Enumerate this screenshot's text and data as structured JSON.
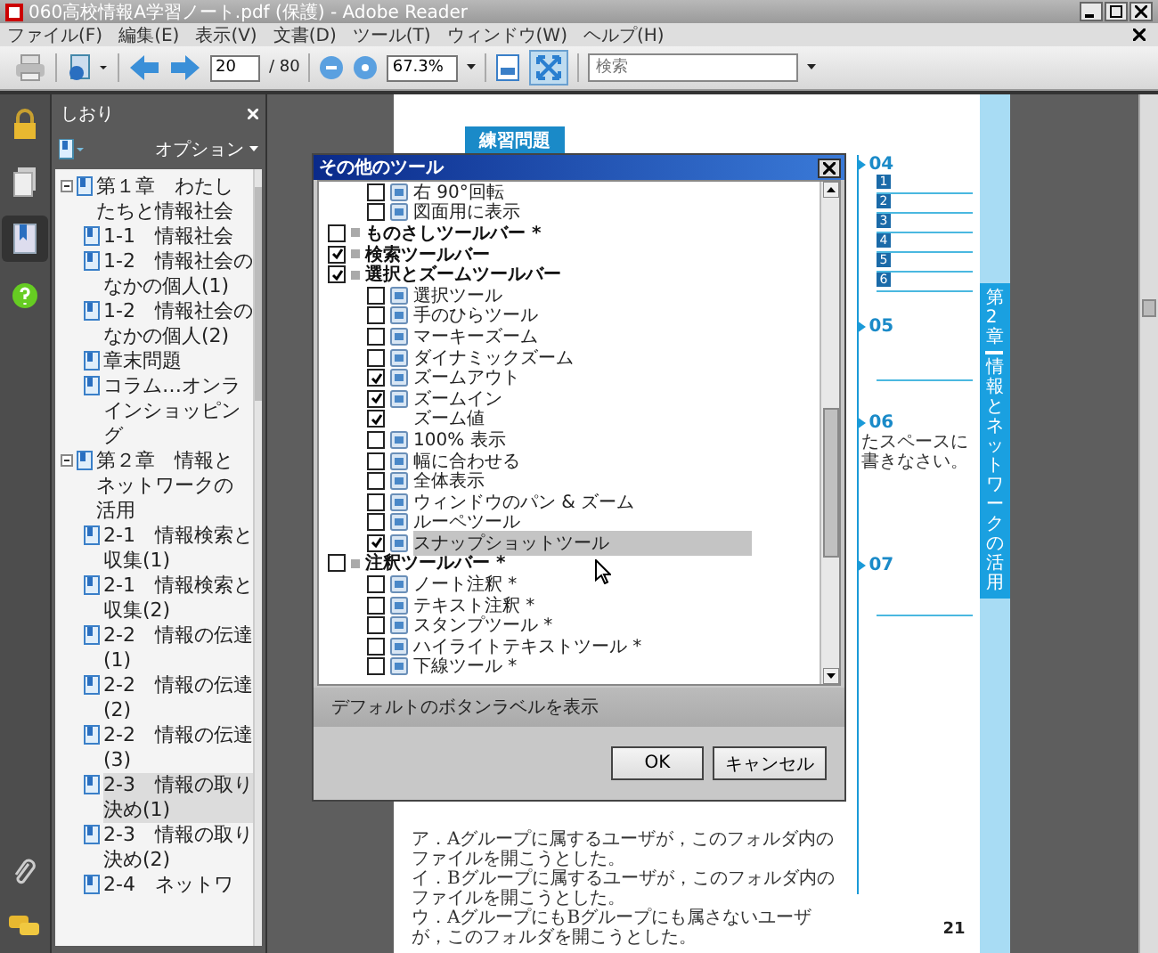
{
  "window": {
    "title": "060高校情報A学習ノート.pdf (保護) - Adobe Reader"
  },
  "menu": [
    "ファイル(F)",
    "編集(E)",
    "表示(V)",
    "文書(D)",
    "ツール(T)",
    "ウィンドウ(W)",
    "ヘルプ(H)"
  ],
  "toolbar": {
    "page": "20",
    "page_total": "/ 80",
    "zoom": "67.3%",
    "search": {
      "placeholder": "検索"
    },
    "full_screen": {
      "selected": true
    }
  },
  "rail": [
    {
      "kind": "lock",
      "selected": false
    },
    {
      "kind": "pages",
      "selected": false
    },
    {
      "kind": "bookmarks",
      "selected": true
    },
    {
      "kind": "help",
      "selected": false
    }
  ],
  "bookmarks": {
    "title": "しおり",
    "options": "オプション",
    "items": [
      {
        "label": "第１章　わたしたちと情報社会",
        "expanded": true,
        "selected": false,
        "children": [
          {
            "label": "1-1　情報社会",
            "selected": false
          },
          {
            "label": "1-2　情報社会のなかの個人(1)",
            "selected": false
          },
          {
            "label": "1-2　情報社会のなかの個人(2)",
            "selected": false
          },
          {
            "label": "章末問題",
            "selected": false
          },
          {
            "label": "コラム…オンラインショッピング",
            "selected": false
          }
        ]
      },
      {
        "label": "第２章　情報とネットワークの活用",
        "expanded": true,
        "selected": false,
        "children": [
          {
            "label": "2-1　情報検索と収集(1)",
            "selected": false
          },
          {
            "label": "2-1　情報検索と収集(2)",
            "selected": false
          },
          {
            "label": "2-2　情報の伝達(1)",
            "selected": false
          },
          {
            "label": "2-2　情報の伝達(2)",
            "selected": false
          },
          {
            "label": "2-2　情報の伝達(3)",
            "selected": false
          },
          {
            "label": "2-3　情報の取り決め(1)",
            "selected": true
          },
          {
            "label": "2-3　情報の取り決め(2)",
            "selected": false
          },
          {
            "label": "2-4　ネットワ",
            "selected": false
          }
        ]
      }
    ]
  },
  "document": {
    "section": "練習問題",
    "answers": [
      {
        "number": "04",
        "blanks": [
          "1",
          "2",
          "3",
          "4",
          "5",
          "6"
        ]
      },
      {
        "number": "05"
      },
      {
        "number": "06",
        "note": "たスペースに書きなさい。"
      },
      {
        "number": "07"
      }
    ],
    "side_tab": {
      "chapter": "第2章",
      "title": "情報とネットワークの活用"
    },
    "choices": [
      "ア．Aグループに属するユーザが，このフォルダ内のファイルを開こうとした。",
      "イ．Bグループに属するユーザが，このフォルダ内のファイルを開こうとした。",
      "ウ．AグループにもBグループにも属さないユーザが，このフォルダを開こうとした。"
    ],
    "page_number": "21"
  },
  "dialog": {
    "title": "その他のツール",
    "groups": [
      {
        "children": [
          {
            "label": "右 90°回転",
            "checked": false,
            "icon": true,
            "selected": false
          },
          {
            "label": "図面用に表示",
            "checked": false,
            "icon": true,
            "selected": false
          }
        ]
      },
      {
        "label": "ものさしツールバー *",
        "checked": false
      },
      {
        "label": "検索ツールバー",
        "checked": true
      },
      {
        "label": "選択とズームツールバー",
        "checked": true,
        "children": [
          {
            "label": "選択ツール",
            "checked": false,
            "icon": true,
            "selected": false
          },
          {
            "label": "手のひらツール",
            "checked": false,
            "icon": true,
            "selected": false
          },
          {
            "label": "マーキーズーム",
            "checked": false,
            "icon": true,
            "selected": false
          },
          {
            "label": "ダイナミックズーム",
            "checked": false,
            "icon": true,
            "selected": false
          },
          {
            "label": "ズームアウト",
            "checked": true,
            "icon": true,
            "selected": false
          },
          {
            "label": "ズームイン",
            "checked": true,
            "icon": true,
            "selected": false
          },
          {
            "label": "ズーム値",
            "checked": true,
            "icon": false,
            "selected": false
          },
          {
            "label": "100% 表示",
            "checked": false,
            "icon": true,
            "selected": false
          },
          {
            "label": "幅に合わせる",
            "checked": false,
            "icon": true,
            "selected": false
          },
          {
            "label": "全体表示",
            "checked": false,
            "icon": true,
            "selected": false
          },
          {
            "label": "ウィンドウのパン & ズーム",
            "checked": false,
            "icon": true,
            "selected": false
          },
          {
            "label": "ルーペツール",
            "checked": false,
            "icon": true,
            "selected": false
          },
          {
            "label": "スナップショットツール",
            "checked": true,
            "icon": true,
            "selected": true
          }
        ]
      },
      {
        "label": "注釈ツールバー *",
        "checked": false,
        "children": [
          {
            "label": "ノート注釈 *",
            "checked": false,
            "icon": true,
            "selected": false
          },
          {
            "label": "テキスト注釈 *",
            "checked": false,
            "icon": true,
            "selected": false
          },
          {
            "label": "スタンプツール *",
            "checked": false,
            "icon": true,
            "selected": false
          },
          {
            "label": "ハイライトテキストツール *",
            "checked": false,
            "icon": true,
            "selected": false
          },
          {
            "label": "下線ツール *",
            "checked": false,
            "icon": true,
            "selected": false
          }
        ]
      }
    ],
    "footer": "デフォルトのボタンラベルを表示",
    "buttons": [
      "OK",
      "キャンセル"
    ]
  }
}
